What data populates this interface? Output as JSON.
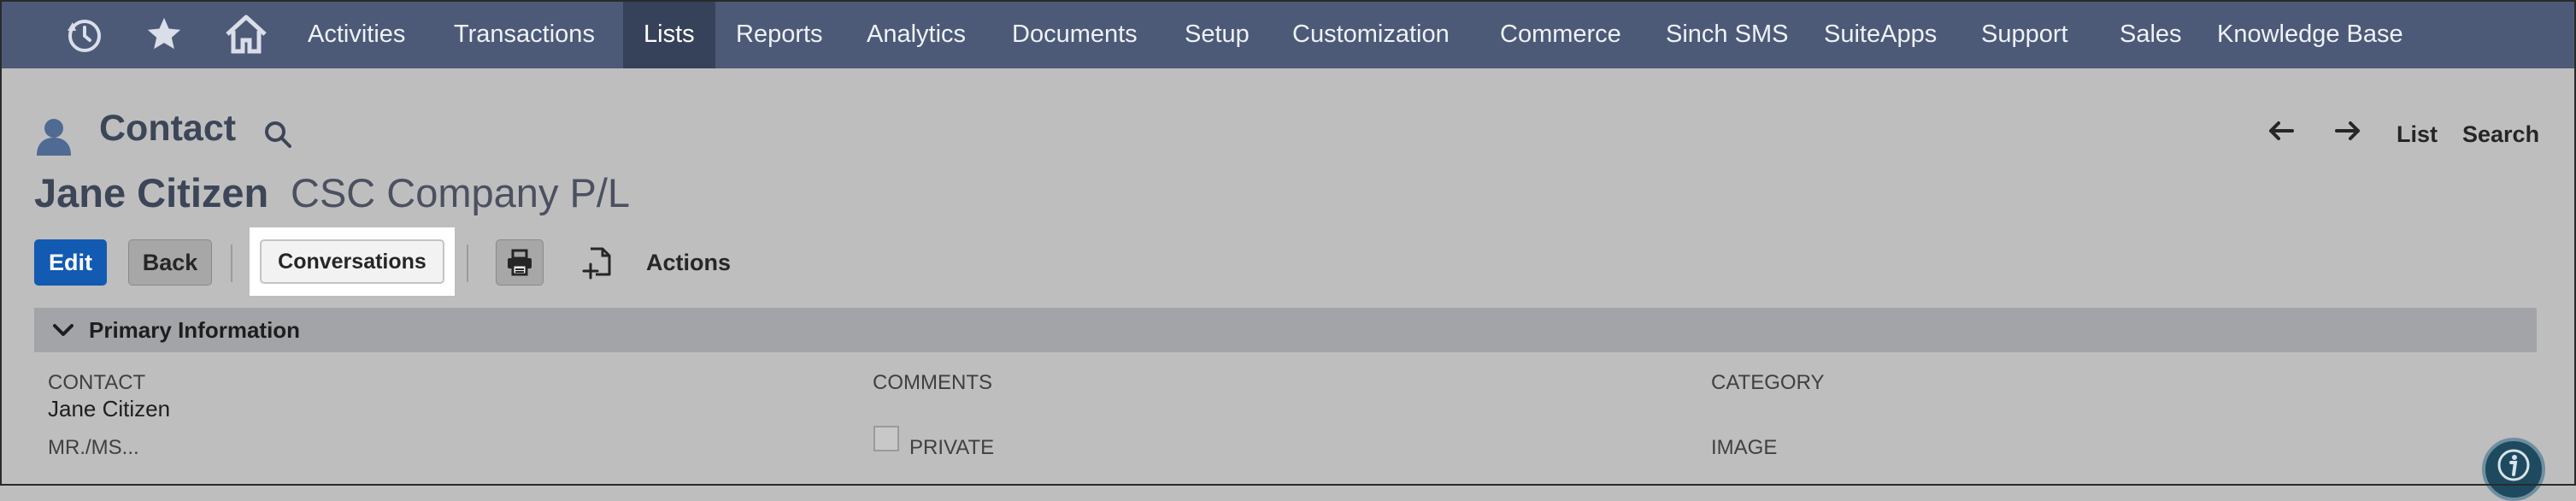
{
  "nav": {
    "items": [
      {
        "label": "Activities",
        "active": false
      },
      {
        "label": "Transactions",
        "active": false
      },
      {
        "label": "Lists",
        "active": true
      },
      {
        "label": "Reports",
        "active": false
      },
      {
        "label": "Analytics",
        "active": false
      },
      {
        "label": "Documents",
        "active": false
      },
      {
        "label": "Setup",
        "active": false
      },
      {
        "label": "Customization",
        "active": false
      },
      {
        "label": "Commerce",
        "active": false
      },
      {
        "label": "Sinch SMS",
        "active": false
      },
      {
        "label": "SuiteApps",
        "active": false
      },
      {
        "label": "Support",
        "active": false
      },
      {
        "label": "Sales",
        "active": false
      },
      {
        "label": "Knowledge Base",
        "active": false
      }
    ],
    "icons": [
      "recent-records-icon",
      "star-icon",
      "home-icon"
    ]
  },
  "header": {
    "record_type": "Contact",
    "record_name": "Jane Citizen",
    "company": "CSC Company P/L",
    "nav_list": "List",
    "nav_search": "Search"
  },
  "toolbar": {
    "edit": "Edit",
    "back": "Back",
    "conversations": "Conversations",
    "actions": "Actions"
  },
  "section": {
    "title": "Primary Information"
  },
  "fields": {
    "contact_label": "CONTACT",
    "contact_value": "Jane Citizen",
    "salutation_label": "MR./MS...",
    "comments_label": "COMMENTS",
    "private_label": "PRIVATE",
    "category_label": "CATEGORY",
    "image_label": "IMAGE"
  },
  "colors": {
    "nav_bg": "#4c5a78",
    "nav_active": "#36425a",
    "page_bg": "#bebebe",
    "edit_button": "#125ab2",
    "section_bar": "#a2a4a8"
  }
}
